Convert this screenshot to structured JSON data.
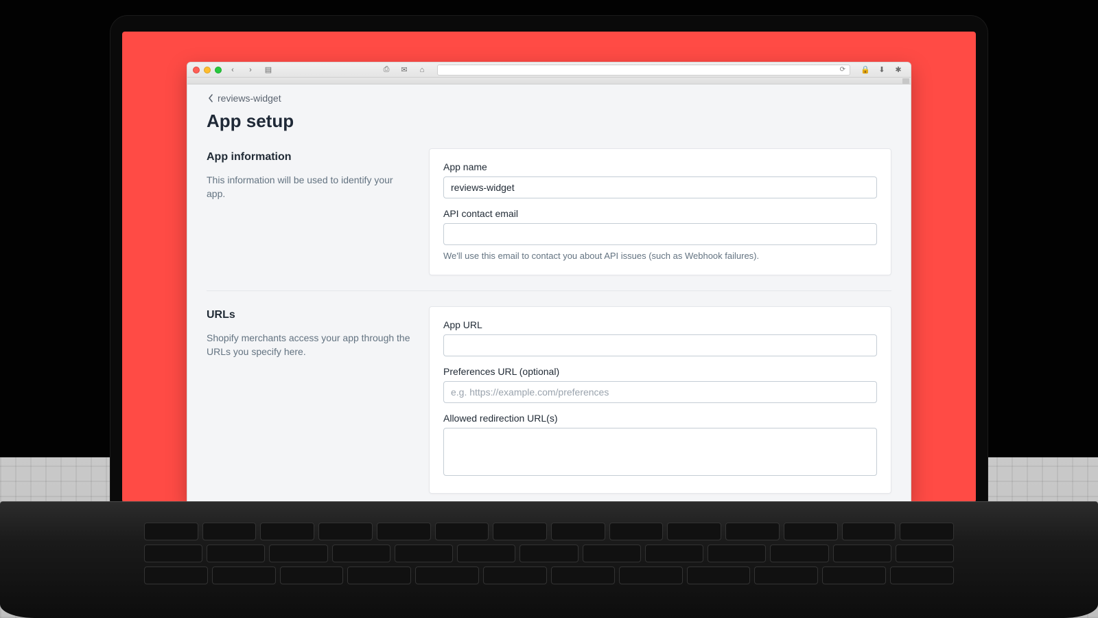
{
  "breadcrumb": {
    "label": "reviews-widget"
  },
  "page": {
    "title": "App setup"
  },
  "sections": {
    "app_info": {
      "heading": "App information",
      "description": "This information will be used to identify your app.",
      "fields": {
        "app_name": {
          "label": "App name",
          "value": "reviews-widget"
        },
        "api_email": {
          "label": "API contact email",
          "value": "",
          "help": "We'll use this email to contact you about API issues (such as Webhook failures)."
        }
      }
    },
    "urls": {
      "heading": "URLs",
      "description": "Shopify merchants access your app through the URLs you specify here.",
      "fields": {
        "app_url": {
          "label": "App URL",
          "value": ""
        },
        "preferences_url": {
          "label": "Preferences URL (optional)",
          "value": "",
          "placeholder": "e.g. https://example.com/preferences"
        },
        "allowed_redirection": {
          "label": "Allowed redirection URL(s)",
          "value": ""
        }
      }
    }
  },
  "toolbar": {
    "back": "‹",
    "forward": "›",
    "sidebar": "▤",
    "reader": "⎙",
    "mail": "✉",
    "home": "⌂",
    "refresh": "⟳",
    "lock": "🔒",
    "download": "⬇",
    "settings": "✱"
  }
}
